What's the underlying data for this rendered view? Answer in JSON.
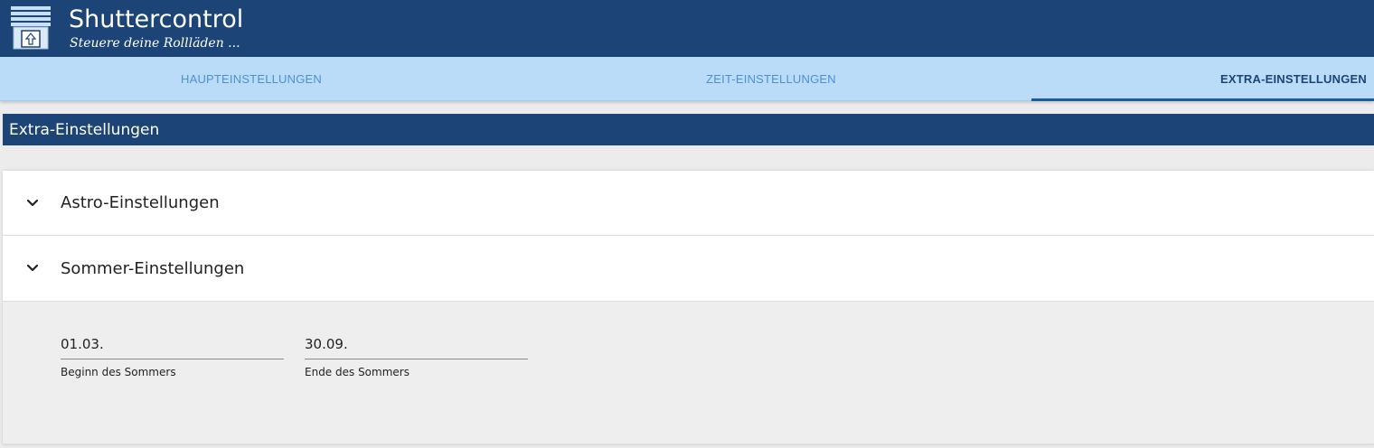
{
  "header": {
    "title": "Shuttercontrol",
    "subtitle": "Steuere deine Rollläden ...",
    "logo_icon": "shutter-icon",
    "background": "#1c4476"
  },
  "tabs": [
    {
      "label": "HAUPTEINSTELLUNGEN",
      "active": false
    },
    {
      "label": "ZEIT-EINSTELLUNGEN",
      "active": false
    },
    {
      "label": "EXTRA-EINSTELLUNGEN",
      "active": true
    }
  ],
  "section": {
    "title": "Extra-Einstellungen"
  },
  "accordion": {
    "items": [
      {
        "label": "Astro-Einstellungen",
        "expanded": false,
        "icon": "chevron-down-icon"
      },
      {
        "label": "Sommer-Einstellungen",
        "expanded": true,
        "icon": "chevron-down-icon"
      }
    ],
    "summer_fields": [
      {
        "value": "01.03.",
        "label": "Beginn des Sommers"
      },
      {
        "value": "30.09.",
        "label": "Ende des Sommers"
      }
    ]
  },
  "colors": {
    "primary": "#1c4476",
    "tab_bar": "#bbdcf9",
    "tab_text": "#4d8fd6",
    "background": "#ececec"
  }
}
